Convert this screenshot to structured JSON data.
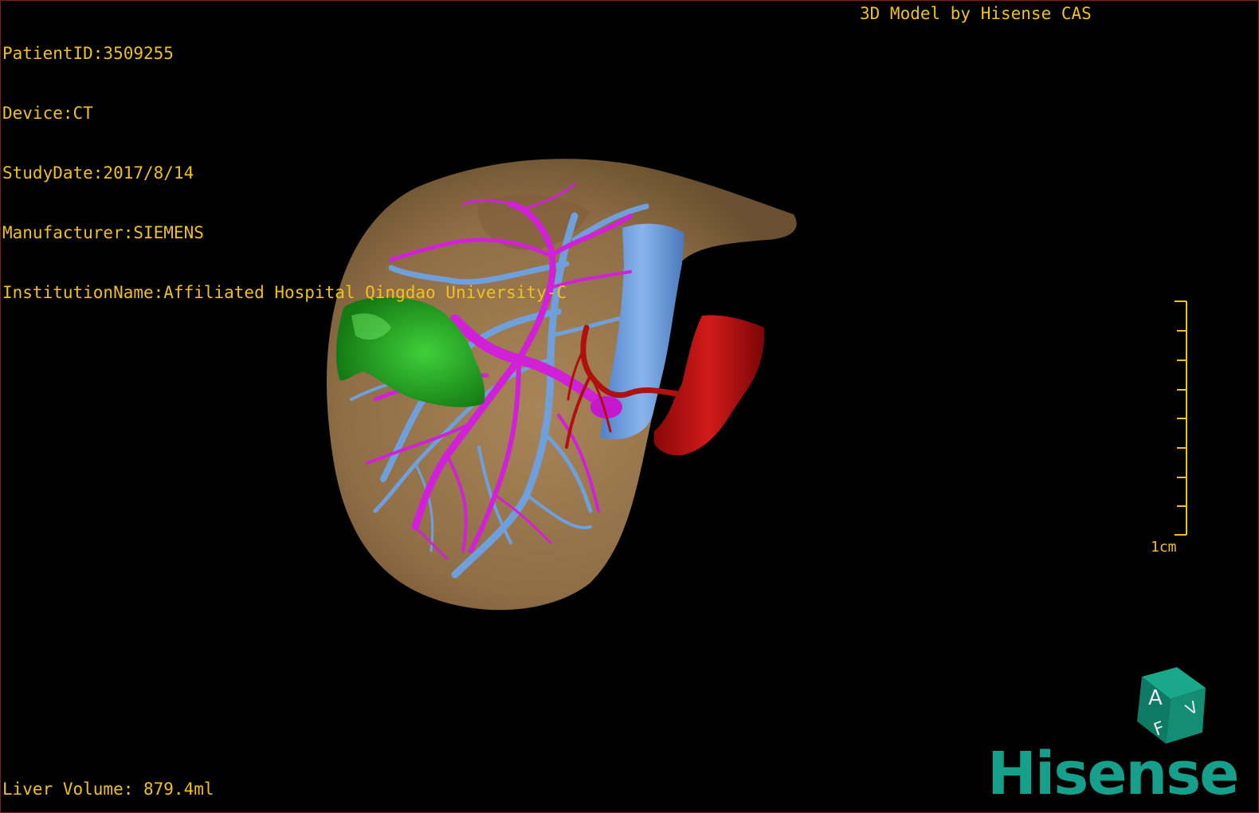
{
  "overlay": {
    "patient_id": "PatientID:3509255",
    "device": "Device:CT",
    "study_date": "StudyDate:2017/8/14",
    "manufacturer": "Manufacturer:SIEMENS",
    "institution": "InstitutionName:Affiliated Hospital Qingdao University-C",
    "brand_caption": "3D Model by Hisense CAS",
    "liver_volume": "Liver Volume: 879.4ml"
  },
  "scale_bar": {
    "label": "1cm"
  },
  "orientation_cube": {
    "letters": [
      "A",
      "F",
      "V"
    ]
  },
  "logo": {
    "text": "Hisense"
  },
  "colors": {
    "overlay_text": "#f0c020",
    "liver": "#9c7a4e",
    "portal_vein": "#d020d8",
    "hepatic_vein": "#6fa0dc",
    "lesion": "#22a020",
    "artery": "#b01010",
    "logo": "#16a08c"
  }
}
